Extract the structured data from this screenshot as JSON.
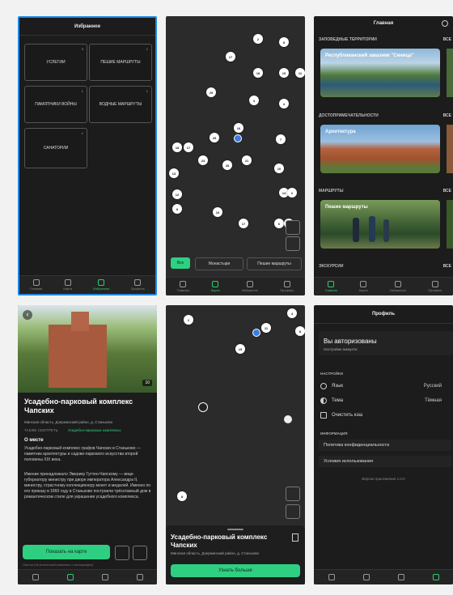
{
  "colors": {
    "accent": "#2fcf82",
    "selection_border": "#1e88e5",
    "user_location": "#3b7de0"
  },
  "favorites": {
    "title": "Избранное",
    "cards": [
      {
        "label": "УСЛЕГИИ",
        "count": "3"
      },
      {
        "label": "ПЕШИЕ МАРШРУТЫ",
        "count": "1"
      },
      {
        "label": "ПАМЯТНИКИ ВОЙНЫ",
        "count": "1"
      },
      {
        "label": "ВОДНЫЕ МАРШРУТЫ",
        "count": "1"
      },
      {
        "label": "САНАТОРИИ",
        "count": "1"
      }
    ]
  },
  "map1": {
    "pins": [
      "2",
      "8",
      "17",
      "18",
      "19",
      "11",
      "3",
      "4",
      "29",
      "25",
      "16",
      "7",
      "18",
      "17",
      "24",
      "28",
      "21",
      "10",
      "13",
      "12",
      "14",
      "2",
      "8",
      "16",
      "17",
      "6",
      "8"
    ],
    "chips": [
      "Все",
      "Монастыри",
      "Пешие маршруты"
    ]
  },
  "main": {
    "title": "Главная",
    "sections": [
      {
        "header": "ЗАПОВЕДНЫЕ ТЕРРИТОРИИ",
        "all": "ВСЕ",
        "card_title": "Республиканский заказник \"Синица\""
      },
      {
        "header": "ДОСТОПРИМЕЧАТЕЛЬНОСТИ",
        "all": "ВСЕ",
        "card_title": "Архитектура"
      },
      {
        "header": "МАРШРУТЫ",
        "all": "ВСЕ",
        "card_title": "Пешие маршруты"
      },
      {
        "header": "ЭКСКУРСИИ",
        "all": "ВСЕ",
        "card_title": ""
      }
    ]
  },
  "detail": {
    "back": "‹",
    "photo_count": "10",
    "title": "Усадебно-парковый комплекс Чапских",
    "location": "Минская область, Дзержинский район, д. Станьково",
    "tags": "ТАКЖЕ СМОТРЕТЬ",
    "tags_link": "Усадебно-парковые комплексы",
    "about_h": "О месте",
    "para1": "Усадебно-парковый комплекс графов Чапских в Станьково — памятник архитектуры и садово-паркового искусства второй половины XIX века.",
    "para2": "Имение принадлежало Эмерику Гуттен-Чапскому — вице-губернатору министру при дворе императора Александра II, министру, страстному коллекционеру монет и медалей. Именно по его приказу в 1860 году в Станьково построили трёхэтажный дом в романтическом стиле для украшения усадебного комплекса.",
    "show_on_map": "Показать на карте",
    "footer": "Листья (Эстетический комплекс и ассоциации)"
  },
  "map2": {
    "pins": [
      "2",
      "4",
      "11",
      "15",
      "8",
      "8"
    ],
    "sheet_title": "Усадебно-парковый комплекс Чапских",
    "sheet_location": "Минская область, Дзержинский район, д. Станьково",
    "sheet_button": "Узнать больше"
  },
  "profile": {
    "title": "Профиль",
    "user_title": "Вы авторизованы",
    "user_sub": "Настройки аккаунта",
    "settings_h": "НАСТРОЙКИ",
    "lang_label": "Язык",
    "lang_value": "Русский",
    "theme_label": "Тема",
    "theme_value": "Тёмная",
    "clear_cache": "Очистить кэш",
    "info_h": "ИНФОРМАЦИЯ",
    "privacy": "Политика конфиденциальности",
    "terms": "Условия использования",
    "version": "Версия приложения 1.0.0"
  },
  "tabs": [
    "Главная",
    "Карта",
    "Избранное",
    "Профиль"
  ]
}
